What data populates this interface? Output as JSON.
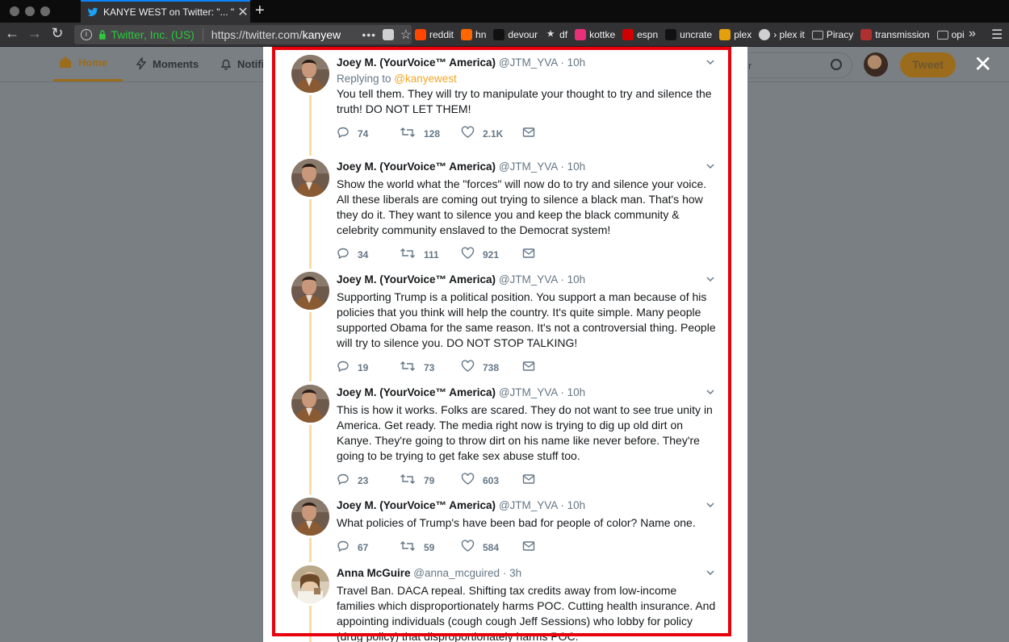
{
  "browser": {
    "tab_title": "KANYE WEST on Twitter: \"... \"",
    "site_identity": "Twitter, Inc. (US)",
    "url_host": "https://twitter.com/",
    "url_path": "kanyew",
    "bookmarks": [
      {
        "label": "reddit",
        "icon": "reddit-icon",
        "color": "#ff4500"
      },
      {
        "label": "hn",
        "icon": "hn-icon",
        "color": "#ff6600"
      },
      {
        "label": "devour",
        "icon": "devour-icon",
        "color": "#111111"
      },
      {
        "label": "df",
        "icon": "star-icon",
        "color": "#444444"
      },
      {
        "label": "kottke",
        "icon": "kottke-icon",
        "color": "#e6307a"
      },
      {
        "label": "espn",
        "icon": "espn-icon",
        "color": "#d00000"
      },
      {
        "label": "uncrate",
        "icon": "uncrate-icon",
        "color": "#111111"
      },
      {
        "label": "plex",
        "icon": "plex-icon",
        "color": "#e5a00d"
      },
      {
        "label": "› plex it",
        "icon": "globe-icon",
        "color": "#555555"
      },
      {
        "label": "Piracy",
        "icon": "folder-icon",
        "color": "#888888"
      },
      {
        "label": "transmission",
        "icon": "transmission-icon",
        "color": "#b03030"
      },
      {
        "label": "opi",
        "icon": "folder-icon",
        "color": "#888888"
      }
    ]
  },
  "twitter": {
    "nav": {
      "home": "Home",
      "moments": "Moments",
      "notifications": "Notifi"
    },
    "search_placeholder": "r",
    "tweet_button": "Tweet"
  },
  "thread": {
    "tweets": [
      {
        "name": "Joey M. (YourVoice™ America)",
        "handle": "@JTM_YVA",
        "time": "· 10h",
        "reply_prefix": "Replying to ",
        "reply_to": "@kanyewest",
        "text": "You tell them. They will try to manipulate your thought to try and silence the truth! DO NOT LET THEM!",
        "replies": "74",
        "retweets": "128",
        "likes": "2.1K"
      },
      {
        "name": "Joey M. (YourVoice™ America)",
        "handle": "@JTM_YVA",
        "time": "· 10h",
        "text": "Show the world what the \"forces\" will now do to try and silence your voice. All these liberals are coming out trying to silence a black man. That's how they do it. They want to silence you and keep the black community & celebrity community enslaved to the Democrat system!",
        "replies": "34",
        "retweets": "111",
        "likes": "921"
      },
      {
        "name": "Joey M. (YourVoice™ America)",
        "handle": "@JTM_YVA",
        "time": "· 10h",
        "text": "Supporting Trump is a political position. You support a man because of his policies that you think will help the country. It's quite simple. Many people supported Obama for the same reason. It's not a controversial thing. People will try to silence you. DO NOT STOP TALKING!",
        "replies": "19",
        "retweets": "73",
        "likes": "738"
      },
      {
        "name": "Joey M. (YourVoice™ America)",
        "handle": "@JTM_YVA",
        "time": "· 10h",
        "text": "This is how it works. Folks are scared. They do not want to see true unity in America. Get ready. The media right now is trying to dig up old dirt on Kanye. They're going to throw dirt on his name like never before. They're going to be trying to get fake sex abuse stuff too.",
        "replies": "23",
        "retweets": "79",
        "likes": "603"
      },
      {
        "name": "Joey M. (YourVoice™ America)",
        "handle": "@JTM_YVA",
        "time": "· 10h",
        "text": "What policies of Trump's have been bad for people of color? Name one.",
        "replies": "67",
        "retweets": "59",
        "likes": "584"
      },
      {
        "name": "Anna McGuire",
        "handle": "@anna_mcguired",
        "time": "· 3h",
        "text": "Travel Ban. DACA repeal. Shifting tax credits away from low-income families which disproportionately harms POC. Cutting health insurance. And appointing individuals (cough cough Jeff Sessions) who lobby for policy (drug policy) that disproportionately harms POC."
      }
    ]
  },
  "colors": {
    "accent": "#f5a623",
    "highlight": "#e8000b",
    "thread_line": "#fbdca0"
  }
}
